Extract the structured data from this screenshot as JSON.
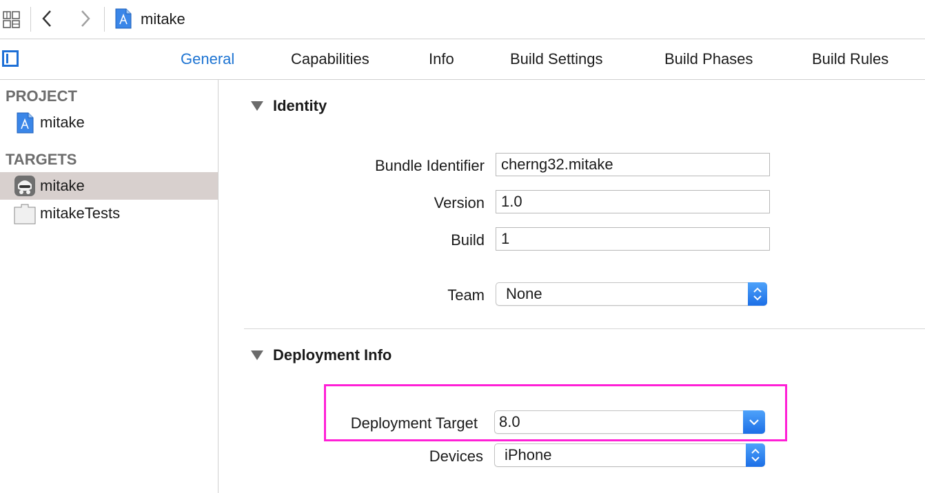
{
  "window": {
    "title": "mitake"
  },
  "tabs": [
    {
      "label": "General",
      "active": true
    },
    {
      "label": "Capabilities",
      "active": false
    },
    {
      "label": "Info",
      "active": false
    },
    {
      "label": "Build Settings",
      "active": false
    },
    {
      "label": "Build Phases",
      "active": false
    },
    {
      "label": "Build Rules",
      "active": false
    }
  ],
  "sidebar": {
    "project_heading": "PROJECT",
    "project_item": "mitake",
    "targets_heading": "TARGETS",
    "targets": [
      {
        "label": "mitake",
        "selected": true
      },
      {
        "label": "mitakeTests",
        "selected": false
      }
    ]
  },
  "identity": {
    "heading": "Identity",
    "bundle_identifier_label": "Bundle Identifier",
    "bundle_identifier_value": "cherng32.mitake",
    "version_label": "Version",
    "version_value": "1.0",
    "build_label": "Build",
    "build_value": "1",
    "team_label": "Team",
    "team_value": "None"
  },
  "deployment": {
    "heading": "Deployment Info",
    "target_label": "Deployment Target",
    "target_value": "8.0",
    "devices_label": "Devices",
    "devices_value": "iPhone"
  },
  "colors": {
    "accent": "#1c73d2",
    "highlight": "#ff1fd6",
    "selection": "#d8d0ce"
  }
}
